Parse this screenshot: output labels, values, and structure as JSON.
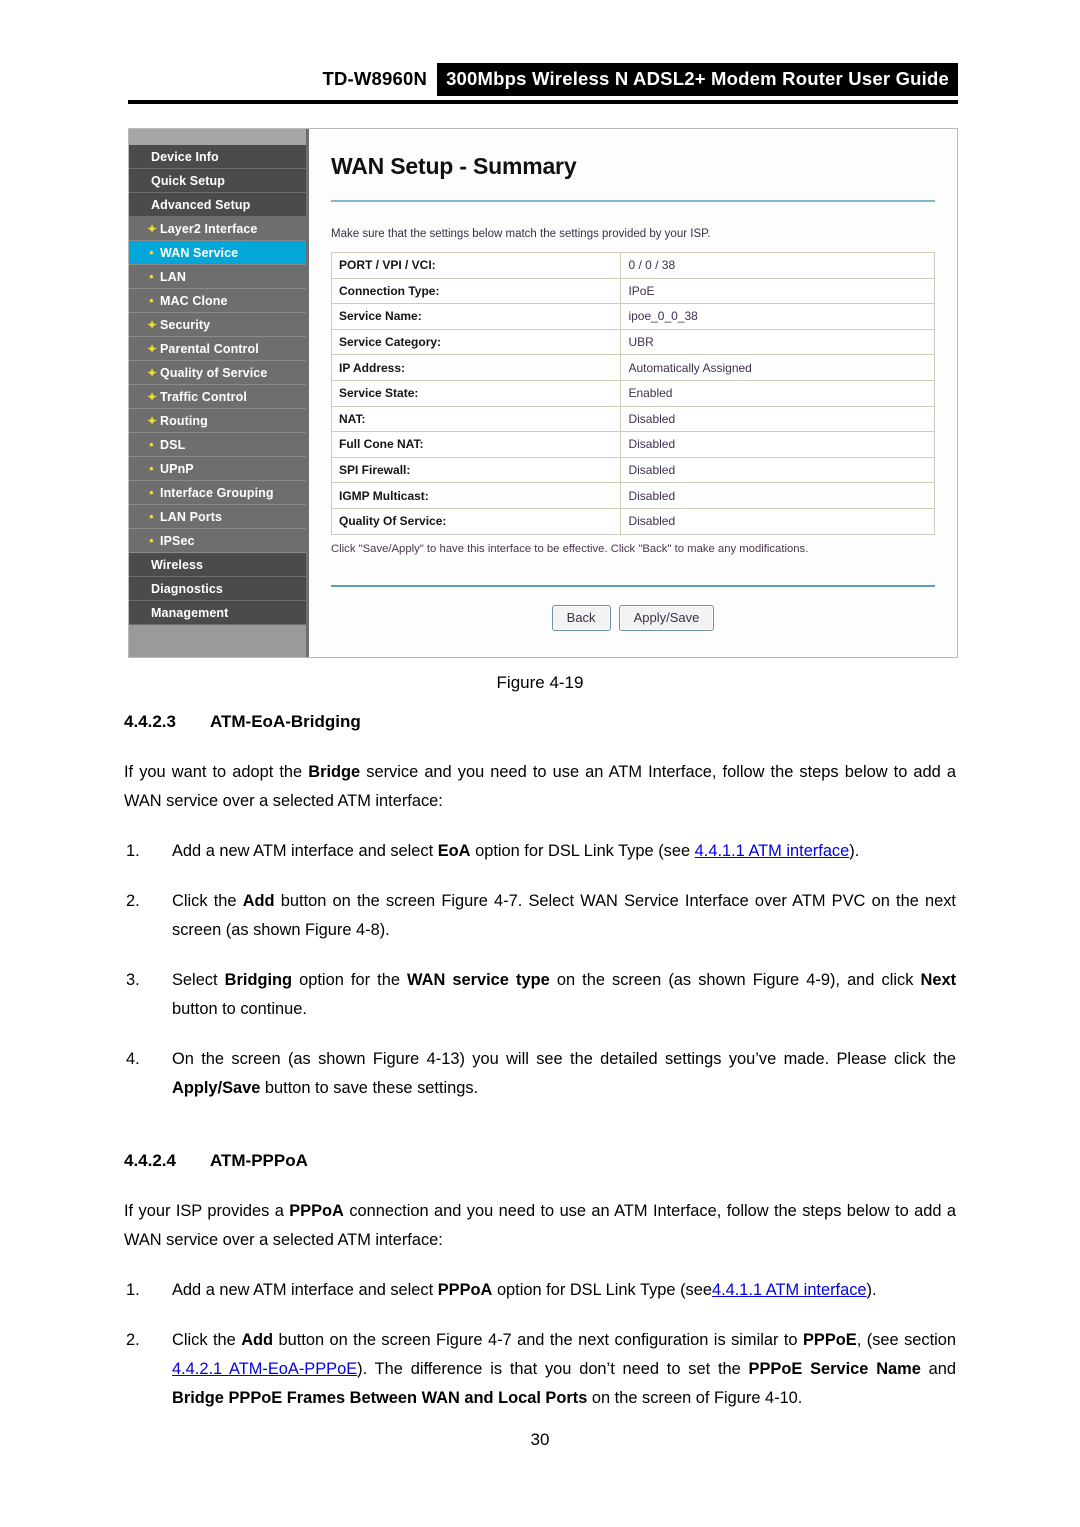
{
  "header": {
    "model": "TD-W8960N",
    "title": "300Mbps Wireless N ADSL2+ Modem Router User Guide"
  },
  "figure": {
    "caption": "Figure 4-19",
    "screenshot": {
      "sidebar": [
        {
          "label": "Device Info",
          "level": "top",
          "bullet": "",
          "active": false
        },
        {
          "label": "Quick Setup",
          "level": "top",
          "bullet": "",
          "active": false
        },
        {
          "label": "Advanced Setup",
          "level": "top",
          "bullet": "",
          "active": false
        },
        {
          "label": "Layer2 Interface",
          "level": "sub",
          "bullet": "plus",
          "active": false
        },
        {
          "label": "WAN Service",
          "level": "sub",
          "bullet": "dot",
          "active": true
        },
        {
          "label": "LAN",
          "level": "sub",
          "bullet": "dot",
          "active": false
        },
        {
          "label": "MAC Clone",
          "level": "sub",
          "bullet": "dot",
          "active": false
        },
        {
          "label": "Security",
          "level": "sub",
          "bullet": "plus",
          "active": false
        },
        {
          "label": "Parental Control",
          "level": "sub",
          "bullet": "plus",
          "active": false
        },
        {
          "label": "Quality of Service",
          "level": "sub",
          "bullet": "plus",
          "active": false
        },
        {
          "label": "Traffic Control",
          "level": "sub",
          "bullet": "plus",
          "active": false
        },
        {
          "label": "Routing",
          "level": "sub",
          "bullet": "plus",
          "active": false
        },
        {
          "label": "DSL",
          "level": "sub",
          "bullet": "dot",
          "active": false
        },
        {
          "label": "UPnP",
          "level": "sub",
          "bullet": "dot",
          "active": false
        },
        {
          "label": "Interface Grouping",
          "level": "sub",
          "bullet": "dot",
          "active": false
        },
        {
          "label": "LAN Ports",
          "level": "sub",
          "bullet": "dot",
          "active": false
        },
        {
          "label": "IPSec",
          "level": "sub",
          "bullet": "dot",
          "active": false
        },
        {
          "label": "Wireless",
          "level": "top",
          "bullet": "",
          "active": false
        },
        {
          "label": "Diagnostics",
          "level": "top",
          "bullet": "",
          "active": false
        },
        {
          "label": "Management",
          "level": "top",
          "bullet": "",
          "active": false
        }
      ],
      "page_title": "WAN Setup - Summary",
      "intro_note": "Make sure that the settings below match the settings provided by your ISP.",
      "rows": [
        {
          "label": "PORT / VPI / VCI:",
          "value": "0 / 0 / 38"
        },
        {
          "label": "Connection Type:",
          "value": "IPoE"
        },
        {
          "label": "Service Name:",
          "value": "ipoe_0_0_38"
        },
        {
          "label": "Service Category:",
          "value": "UBR"
        },
        {
          "label": "IP Address:",
          "value": "Automatically Assigned"
        },
        {
          "label": "Service State:",
          "value": "Enabled"
        },
        {
          "label": "NAT:",
          "value": "Disabled"
        },
        {
          "label": "Full Cone NAT:",
          "value": "Disabled"
        },
        {
          "label": "SPI Firewall:",
          "value": "Disabled"
        },
        {
          "label": "IGMP Multicast:",
          "value": "Disabled"
        },
        {
          "label": "Quality Of Service:",
          "value": "Disabled"
        }
      ],
      "footer_note": "Click \"Save/Apply\" to have this interface to be effective. Click \"Back\" to make any modifications.",
      "buttons": {
        "back": "Back",
        "apply_save": "Apply/Save"
      },
      "accent_color": "#00a7d8"
    }
  },
  "sections": {
    "bridging": {
      "number": "4.4.2.3",
      "title": "ATM-EoA-Bridging",
      "intro_a": "If you want to adopt the ",
      "intro_b": "Bridge",
      "intro_c": " service and you need to use an ATM Interface, follow the steps below to add a WAN service over a selected ATM interface:",
      "step1": {
        "num": "1.",
        "a": "Add a new ATM interface and select ",
        "b": "EoA",
        "c": " option for DSL Link Type (see ",
        "link": "4.4.1.1 ATM interface",
        "d": ")."
      },
      "step2": {
        "num": "2.",
        "a": "Click the ",
        "b": "Add",
        "c": " button on the screen Figure 4-7. Select WAN Service Interface over ATM PVC on the next screen (as shown Figure 4-8)."
      },
      "step3": {
        "num": "3.",
        "a": "Select ",
        "b": "Bridging",
        "c": " option for the ",
        "d": "WAN service type",
        "e": " on the screen (as shown Figure 4-9), and click ",
        "f": "Next",
        "g": " button to continue."
      },
      "step4": {
        "num": "4.",
        "a": "On the screen (as shown Figure 4-13) you will see the detailed settings you’ve made. Please click the ",
        "b": "Apply/Save",
        "c": " button to save these settings."
      }
    },
    "pppoa": {
      "number": "4.4.2.4",
      "title": "ATM-PPPoA",
      "intro_a": "If your ISP provides a ",
      "intro_b": "PPPoA",
      "intro_c": " connection and you need to use an ATM Interface, follow the steps below to add a WAN service over a selected ATM interface:",
      "step1": {
        "num": "1.",
        "a": "Add a new ATM interface and select ",
        "b": "PPPoA",
        "c": " option for DSL Link Type (see",
        "link": "4.4.1.1 ATM interface",
        "d": ")."
      },
      "step2": {
        "num": "2.",
        "a": "Click the ",
        "b": "Add",
        "c": " button on the screen Figure 4-7 and the next configuration is similar to ",
        "d": "PPPoE",
        "e": ", (see section ",
        "link": "4.4.2.1 ATM-EoA-PPPoE",
        "f": "). The difference is that you don’t need to set the ",
        "g": "PPPoE Service Name",
        "h": " and ",
        "i": "Bridge PPPoE Frames Between WAN and Local Ports",
        "j": " on the screen of Figure 4-10."
      }
    }
  },
  "page_number": "30"
}
